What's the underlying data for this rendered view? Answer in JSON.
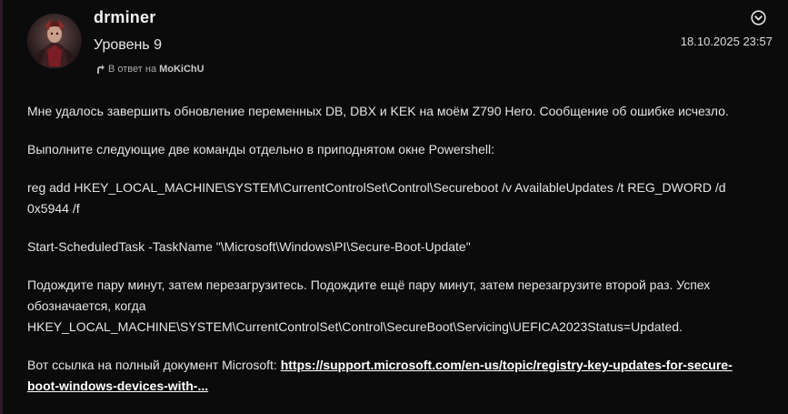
{
  "post": {
    "author": "drminer",
    "rank": "Уровень 9",
    "reply_prefix": "В ответ на",
    "reply_to": "MoKiChU",
    "timestamp": "18.10.2025 23:57"
  },
  "icons": {
    "menu": "chevron-down-circle-icon",
    "reply": "reply-arrow-icon"
  },
  "colors": {
    "background": "#0b0b0c",
    "text": "#e4e4e4",
    "link": "#ffffff"
  },
  "body": {
    "p1": "Мне удалось завершить обновление переменных DB, DBX и KEK на моём Z790 Hero. Сообщение об ошибке исчезло.",
    "p2": "Выполните следующие две команды отдельно в приподнятом окне Powershell:",
    "p3": "reg add HKEY_LOCAL_MACHINE\\SYSTEM\\CurrentControlSet\\Control\\Secureboot /v AvailableUpdates /t REG_DWORD /d 0x5944 /f",
    "p4": "Start-ScheduledTask -TaskName \"\\Microsoft\\Windows\\PI\\Secure-Boot-Update\"",
    "p5": "Подождите пару минут, затем перезагрузитесь. Подождите ещё пару минут, затем перезагрузите второй раз. Успех обозначается, когда HKEY_LOCAL_MACHINE\\SYSTEM\\CurrentControlSet\\Control\\SecureBoot\\Servicing\\UEFICA2023Status=Updated.",
    "p6_prefix": "Вот ссылка на полный документ Microsoft: ",
    "p6_link": "https://support.microsoft.com/en-us/topic/registry-key-updates-for-secure-boot-windows-devices-with-..."
  }
}
